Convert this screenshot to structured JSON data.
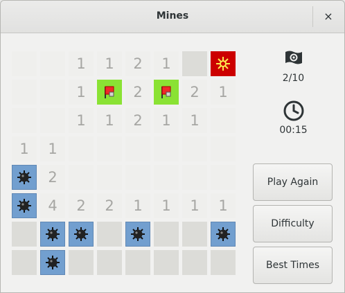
{
  "window": {
    "title": "Mines",
    "close_glyph": "×"
  },
  "game": {
    "flags_label": "2/10",
    "time_label": "00:15",
    "flag_counter_icon": "flag-icon",
    "timer_icon": "clock-icon",
    "grid_size": [
      8,
      8
    ],
    "rows": [
      [
        "",
        "",
        "1",
        "1",
        "2",
        "1",
        "C",
        "X"
      ],
      [
        "",
        "",
        "1",
        "F",
        "2",
        "F",
        "2",
        "1"
      ],
      [
        "",
        "",
        "1",
        "1",
        "2",
        "1",
        "1",
        ""
      ],
      [
        "1",
        "1",
        "",
        "",
        "",
        "",
        "",
        ""
      ],
      [
        "M",
        "2",
        "",
        "",
        "",
        "",
        "",
        ""
      ],
      [
        "M",
        "4",
        "2",
        "2",
        "1",
        "1",
        "1",
        "1"
      ],
      [
        "C",
        "M",
        "M",
        "C",
        "M",
        "C",
        "C",
        "M"
      ],
      [
        "C",
        "M",
        "C",
        "C",
        "C",
        "C",
        "C",
        "C"
      ]
    ],
    "legend": {
      "C": "covered",
      "X": "exploded-mine",
      "F": "flagged",
      "M": "mine",
      "": "empty"
    }
  },
  "buttons": {
    "play_again": "Play Again",
    "difficulty": "Difficulty",
    "best_times": "Best Times"
  },
  "colors": {
    "flag": "#8ae234",
    "mine": "#729fcf",
    "exploded": "#cc0000"
  }
}
